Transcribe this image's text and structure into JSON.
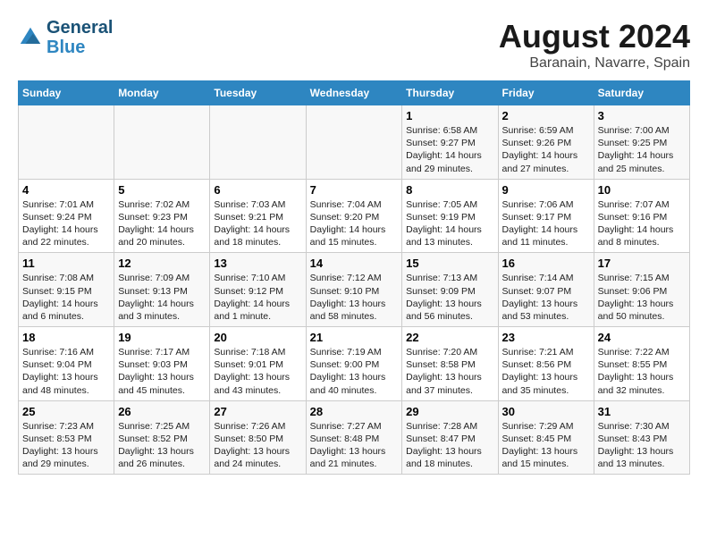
{
  "header": {
    "logo_line1": "General",
    "logo_line2": "Blue",
    "month_title": "August 2024",
    "subtitle": "Baranain, Navarre, Spain"
  },
  "weekdays": [
    "Sunday",
    "Monday",
    "Tuesday",
    "Wednesday",
    "Thursday",
    "Friday",
    "Saturday"
  ],
  "weeks": [
    [
      {
        "day": "",
        "content": ""
      },
      {
        "day": "",
        "content": ""
      },
      {
        "day": "",
        "content": ""
      },
      {
        "day": "",
        "content": ""
      },
      {
        "day": "1",
        "content": "Sunrise: 6:58 AM\nSunset: 9:27 PM\nDaylight: 14 hours\nand 29 minutes."
      },
      {
        "day": "2",
        "content": "Sunrise: 6:59 AM\nSunset: 9:26 PM\nDaylight: 14 hours\nand 27 minutes."
      },
      {
        "day": "3",
        "content": "Sunrise: 7:00 AM\nSunset: 9:25 PM\nDaylight: 14 hours\nand 25 minutes."
      }
    ],
    [
      {
        "day": "4",
        "content": "Sunrise: 7:01 AM\nSunset: 9:24 PM\nDaylight: 14 hours\nand 22 minutes."
      },
      {
        "day": "5",
        "content": "Sunrise: 7:02 AM\nSunset: 9:23 PM\nDaylight: 14 hours\nand 20 minutes."
      },
      {
        "day": "6",
        "content": "Sunrise: 7:03 AM\nSunset: 9:21 PM\nDaylight: 14 hours\nand 18 minutes."
      },
      {
        "day": "7",
        "content": "Sunrise: 7:04 AM\nSunset: 9:20 PM\nDaylight: 14 hours\nand 15 minutes."
      },
      {
        "day": "8",
        "content": "Sunrise: 7:05 AM\nSunset: 9:19 PM\nDaylight: 14 hours\nand 13 minutes."
      },
      {
        "day": "9",
        "content": "Sunrise: 7:06 AM\nSunset: 9:17 PM\nDaylight: 14 hours\nand 11 minutes."
      },
      {
        "day": "10",
        "content": "Sunrise: 7:07 AM\nSunset: 9:16 PM\nDaylight: 14 hours\nand 8 minutes."
      }
    ],
    [
      {
        "day": "11",
        "content": "Sunrise: 7:08 AM\nSunset: 9:15 PM\nDaylight: 14 hours\nand 6 minutes."
      },
      {
        "day": "12",
        "content": "Sunrise: 7:09 AM\nSunset: 9:13 PM\nDaylight: 14 hours\nand 3 minutes."
      },
      {
        "day": "13",
        "content": "Sunrise: 7:10 AM\nSunset: 9:12 PM\nDaylight: 14 hours\nand 1 minute."
      },
      {
        "day": "14",
        "content": "Sunrise: 7:12 AM\nSunset: 9:10 PM\nDaylight: 13 hours\nand 58 minutes."
      },
      {
        "day": "15",
        "content": "Sunrise: 7:13 AM\nSunset: 9:09 PM\nDaylight: 13 hours\nand 56 minutes."
      },
      {
        "day": "16",
        "content": "Sunrise: 7:14 AM\nSunset: 9:07 PM\nDaylight: 13 hours\nand 53 minutes."
      },
      {
        "day": "17",
        "content": "Sunrise: 7:15 AM\nSunset: 9:06 PM\nDaylight: 13 hours\nand 50 minutes."
      }
    ],
    [
      {
        "day": "18",
        "content": "Sunrise: 7:16 AM\nSunset: 9:04 PM\nDaylight: 13 hours\nand 48 minutes."
      },
      {
        "day": "19",
        "content": "Sunrise: 7:17 AM\nSunset: 9:03 PM\nDaylight: 13 hours\nand 45 minutes."
      },
      {
        "day": "20",
        "content": "Sunrise: 7:18 AM\nSunset: 9:01 PM\nDaylight: 13 hours\nand 43 minutes."
      },
      {
        "day": "21",
        "content": "Sunrise: 7:19 AM\nSunset: 9:00 PM\nDaylight: 13 hours\nand 40 minutes."
      },
      {
        "day": "22",
        "content": "Sunrise: 7:20 AM\nSunset: 8:58 PM\nDaylight: 13 hours\nand 37 minutes."
      },
      {
        "day": "23",
        "content": "Sunrise: 7:21 AM\nSunset: 8:56 PM\nDaylight: 13 hours\nand 35 minutes."
      },
      {
        "day": "24",
        "content": "Sunrise: 7:22 AM\nSunset: 8:55 PM\nDaylight: 13 hours\nand 32 minutes."
      }
    ],
    [
      {
        "day": "25",
        "content": "Sunrise: 7:23 AM\nSunset: 8:53 PM\nDaylight: 13 hours\nand 29 minutes."
      },
      {
        "day": "26",
        "content": "Sunrise: 7:25 AM\nSunset: 8:52 PM\nDaylight: 13 hours\nand 26 minutes."
      },
      {
        "day": "27",
        "content": "Sunrise: 7:26 AM\nSunset: 8:50 PM\nDaylight: 13 hours\nand 24 minutes."
      },
      {
        "day": "28",
        "content": "Sunrise: 7:27 AM\nSunset: 8:48 PM\nDaylight: 13 hours\nand 21 minutes."
      },
      {
        "day": "29",
        "content": "Sunrise: 7:28 AM\nSunset: 8:47 PM\nDaylight: 13 hours\nand 18 minutes."
      },
      {
        "day": "30",
        "content": "Sunrise: 7:29 AM\nSunset: 8:45 PM\nDaylight: 13 hours\nand 15 minutes."
      },
      {
        "day": "31",
        "content": "Sunrise: 7:30 AM\nSunset: 8:43 PM\nDaylight: 13 hours\nand 13 minutes."
      }
    ]
  ]
}
